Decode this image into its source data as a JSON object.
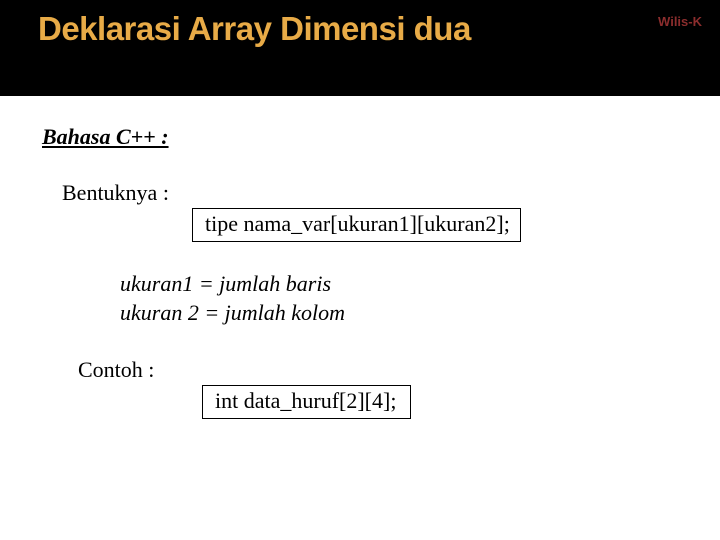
{
  "header": {
    "title": "Deklarasi Array Dimensi dua",
    "author": "Wilis-K"
  },
  "section_label": "Bahasa C++ :",
  "form_label": "Bentuknya :",
  "syntax_box": "tipe nama_var[ukuran1][ukuran2];",
  "explain_line1": "ukuran1 = jumlah baris",
  "explain_line2": "ukuran 2 = jumlah kolom",
  "example_label": "Contoh :",
  "example_box": "int data_huruf[2][4];"
}
